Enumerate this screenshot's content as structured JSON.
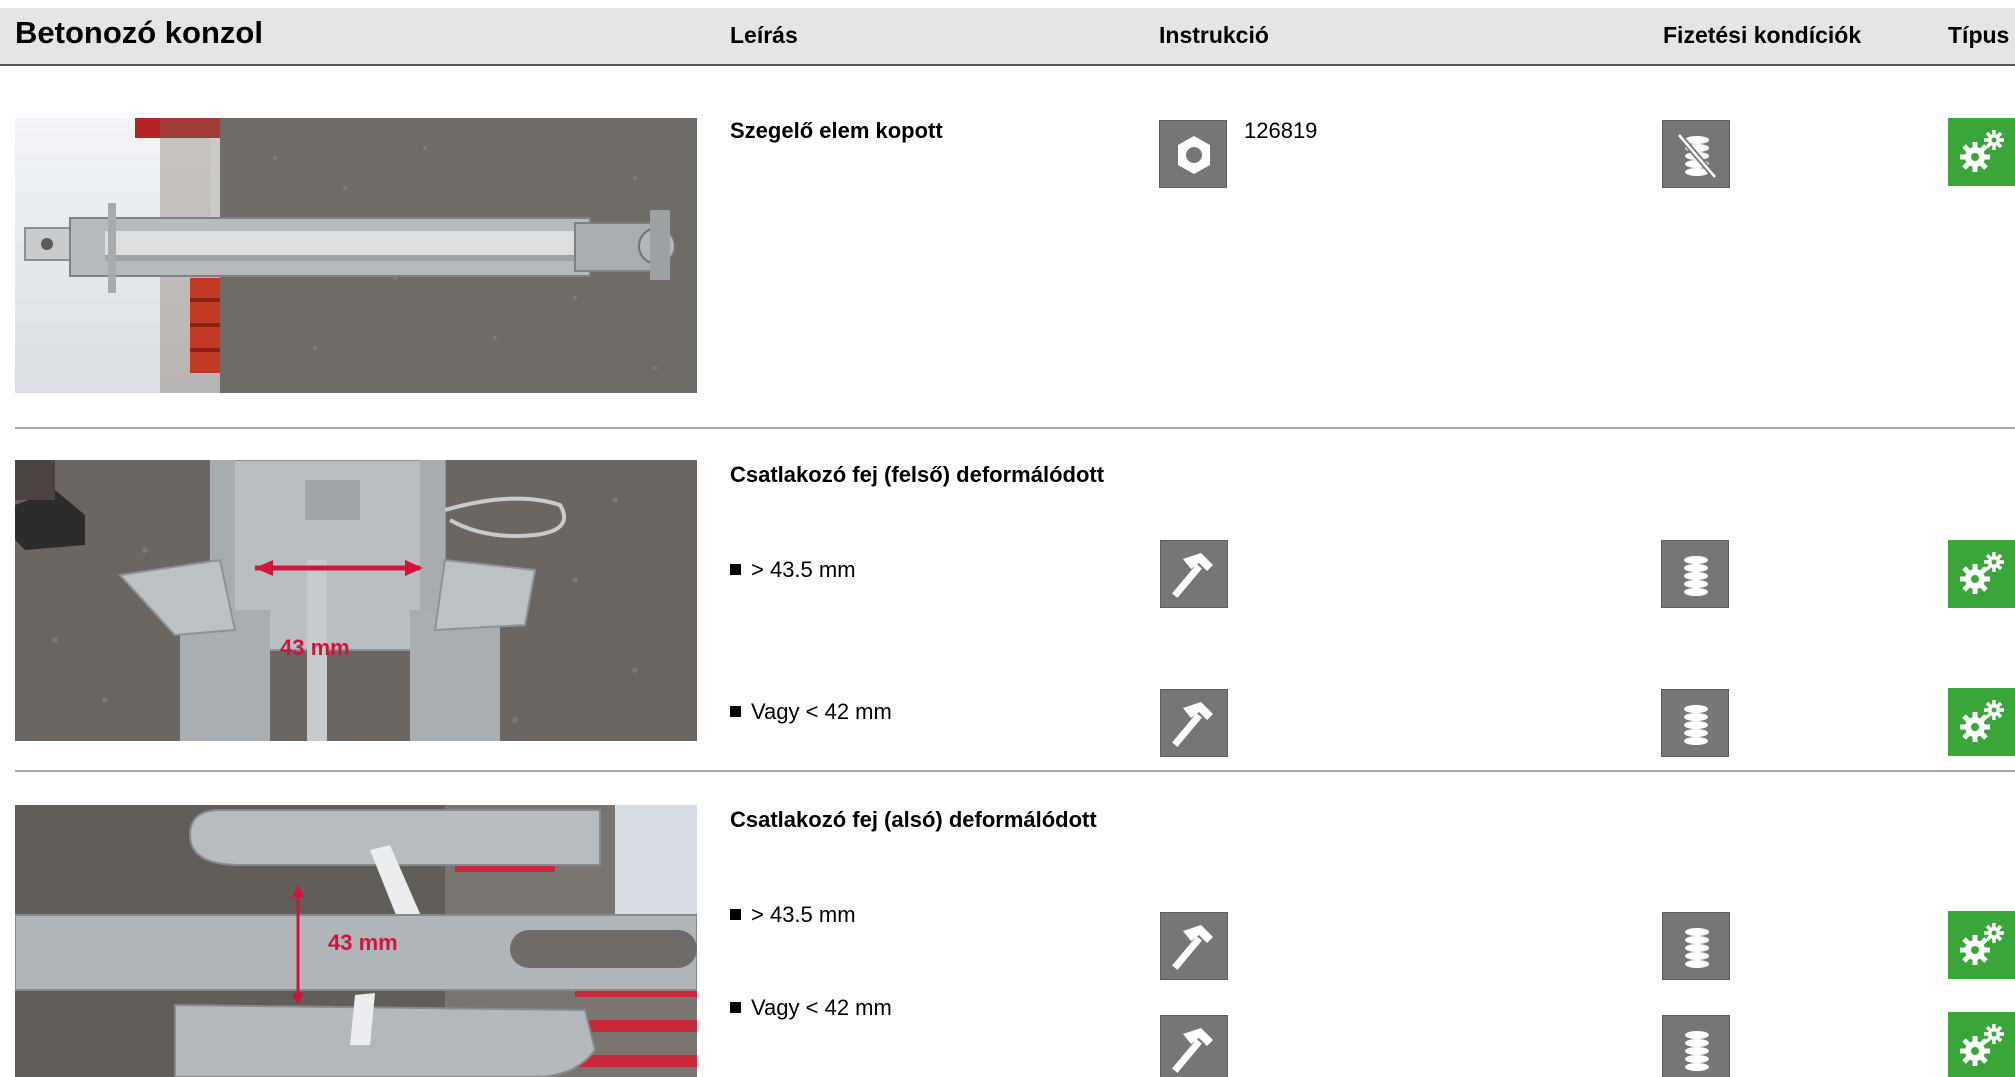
{
  "header": {
    "title": "Betonozó konzol",
    "columns": {
      "leiras": "Leírás",
      "instrukcio": "Instrukció",
      "fizetesi": "Fizetési kondíciók",
      "tipus": "Típus"
    }
  },
  "rows": [
    {
      "title": "Szegelő elem kopott",
      "code": "126819",
      "instruction_icon": "nut-icon",
      "payment_icon": "coins-crossed-icon",
      "type_icon": "gears-icon"
    },
    {
      "title": "Csatlakozó fej (felső) deformálódott",
      "photo_label": "43 mm",
      "items": [
        {
          "text": "> 43.5 mm",
          "instruction_icon": "hammer-icon",
          "payment_icon": "coins-icon",
          "type_icon": "gears-icon"
        },
        {
          "text": "Vagy < 42 mm",
          "instruction_icon": "hammer-icon",
          "payment_icon": "coins-icon",
          "type_icon": "gears-icon"
        }
      ]
    },
    {
      "title": "Csatlakozó fej (alsó) deformálódott",
      "photo_label": "43 mm",
      "items": [
        {
          "text": "> 43.5 mm",
          "instruction_icon": "hammer-icon",
          "payment_icon": "coins-icon",
          "type_icon": "gears-icon"
        },
        {
          "text": "Vagy < 42 mm",
          "instruction_icon": "hammer-icon",
          "payment_icon": "coins-icon",
          "type_icon": "gears-icon"
        }
      ]
    }
  ],
  "colors": {
    "header_bg": "#e5e5e5",
    "icon_gray": "#767676",
    "icon_green": "#3aa63a",
    "measure_red": "#d2143c"
  }
}
